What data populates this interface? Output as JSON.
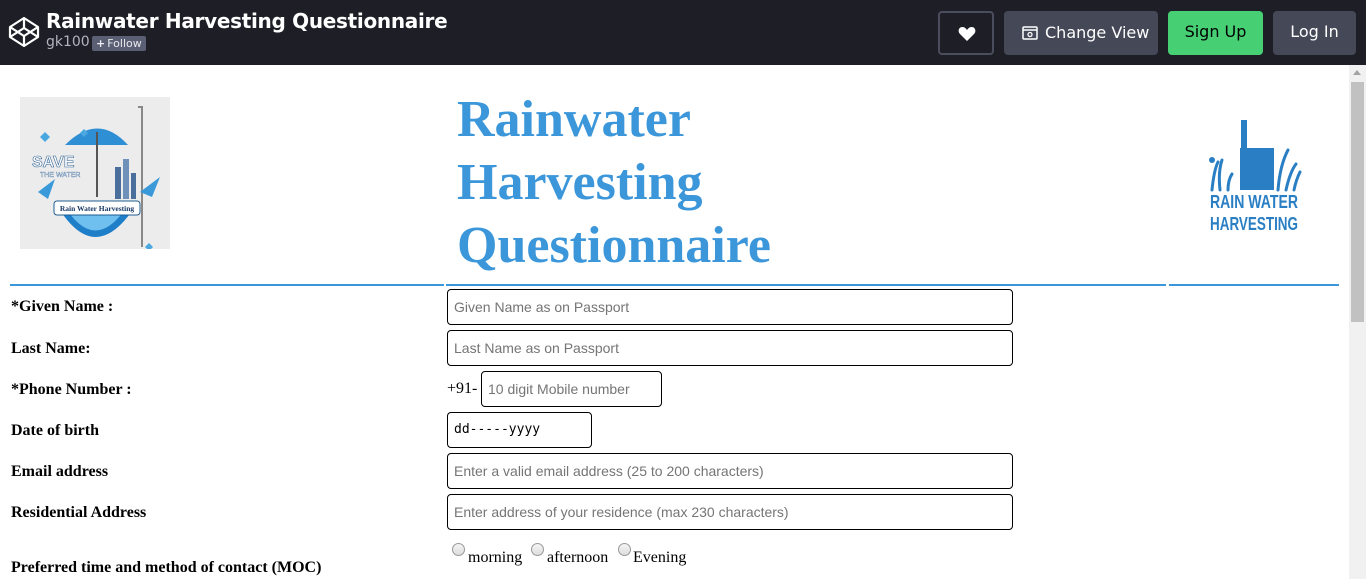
{
  "header": {
    "pen_title": "Rainwater Harvesting Questionnaire",
    "author": "gk100",
    "follow_label": "Follow",
    "change_view_label": "Change View",
    "signup_label": "Sign Up",
    "login_label": "Log In"
  },
  "page": {
    "heading_line1": "Rainwater",
    "heading_line2": "Harvesting",
    "heading_line3": "Questionnaire",
    "left_logo": {
      "save": "SAVE",
      "the_water": "THE WATER",
      "banner": "Rain Water Harvesting"
    },
    "right_logo": {
      "line1": "RAIN WATER",
      "line2": "HARVESTING"
    },
    "accent_color": "#3b96da"
  },
  "form": {
    "given_name": {
      "label": "*Given Name :",
      "placeholder": "Given Name as on Passport"
    },
    "last_name": {
      "label": "Last Name:",
      "placeholder": "Last Name as on Passport"
    },
    "phone": {
      "label": "*Phone Number :",
      "prefix": "+91-",
      "placeholder": "10 digit Mobile number"
    },
    "dob": {
      "label": "Date of birth",
      "placeholder": "dd-----yyyy"
    },
    "email": {
      "label": "Email address",
      "placeholder": "Enter a valid email address (25 to 200 characters)"
    },
    "address": {
      "label": "Residential Address",
      "placeholder": "Enter address of your residence (max 230 characters)"
    },
    "moc": {
      "label": "Preferred time and method of contact (MOC)",
      "options": [
        "morning",
        "afternoon",
        "Evening"
      ]
    }
  }
}
